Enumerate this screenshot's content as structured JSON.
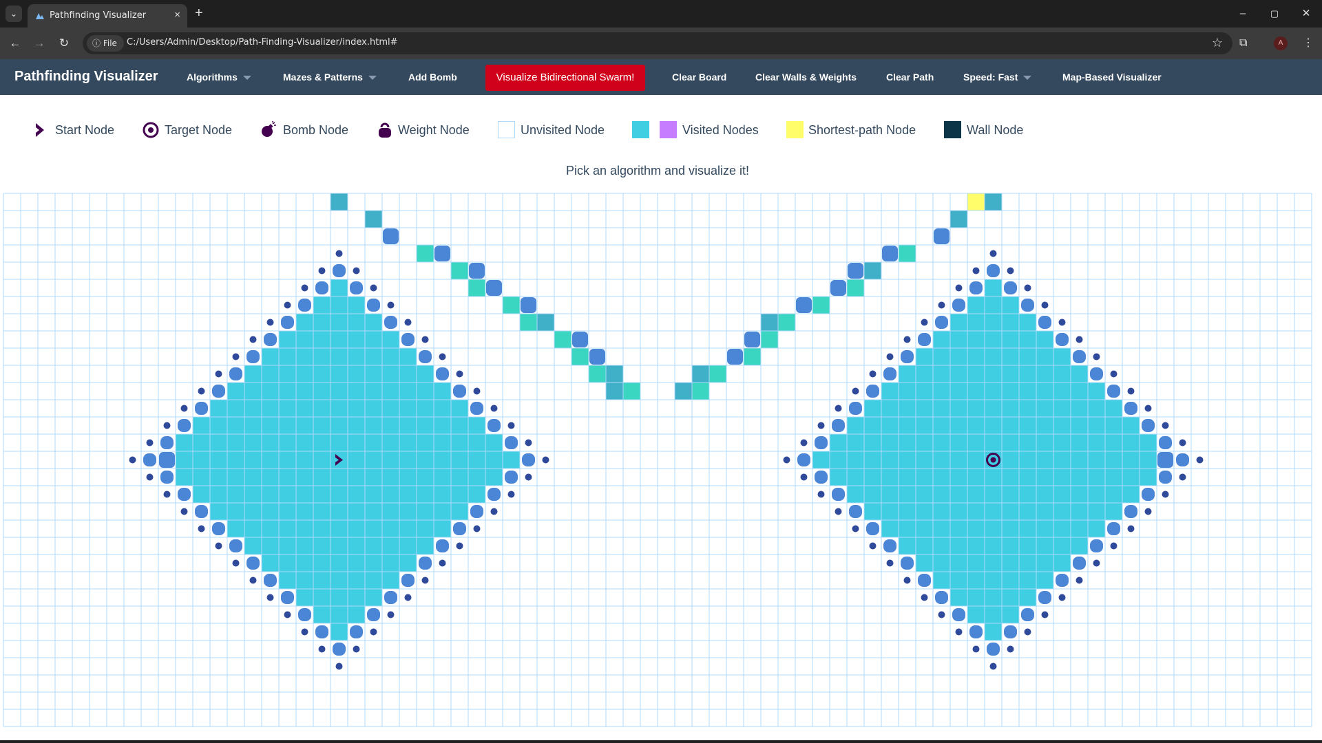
{
  "browser": {
    "tab_title": "Pathfinding Visualizer",
    "tab_close": "×",
    "new_tab": "+",
    "file_chip": "File",
    "url": "C:/Users/Admin/Desktop/Path-Finding-Visualizer/index.html#",
    "profile_initial": "A",
    "window_controls": [
      "–",
      "▢",
      "✕"
    ]
  },
  "nav": {
    "brand": "Pathfinding Visualizer",
    "algorithms": "Algorithms",
    "mazes": "Mazes & Patterns",
    "add_bomb": "Add Bomb",
    "visualize": "Visualize Bidirectional Swarm!",
    "clear_board": "Clear Board",
    "clear_walls": "Clear Walls & Weights",
    "clear_path": "Clear Path",
    "speed": "Speed: Fast",
    "map_based": "Map-Based Visualizer"
  },
  "legend": {
    "start": "Start Node",
    "target": "Target Node",
    "bomb": "Bomb Node",
    "weight": "Weight Node",
    "unvisited": "Unvisited Node",
    "visited": "Visited Nodes",
    "shortest": "Shortest-path Node",
    "wall": "Wall Node"
  },
  "instruction": "Pick an algorithm and visualize it!",
  "colors": {
    "nav_bg": "#34495e",
    "visualize_btn": "#d0021b",
    "visited": "#40cee3",
    "visited_alt": "#c77dff",
    "frontier_teal": "#3ad6c2",
    "frontier_dark": "#3fb0c8",
    "frontier_blue": "#4a85d6",
    "shortest": "#fffe6a",
    "wall": "#0c3547",
    "grid_line": "#afd8f8",
    "node_icon": "#44014f"
  },
  "grid": {
    "rows": 31,
    "cols": 76,
    "start": [
      15,
      19
    ],
    "target": [
      15,
      57
    ],
    "visited_radius": 10,
    "shortest_path_cells": [
      [
        0,
        56
      ]
    ],
    "frontier_cells": [
      [
        0,
        19,
        "dark"
      ],
      [
        1,
        21,
        "dark"
      ],
      [
        2,
        22,
        "blue"
      ],
      [
        3,
        24,
        "teal"
      ],
      [
        3,
        25,
        "blue"
      ],
      [
        4,
        26,
        "teal"
      ],
      [
        4,
        27,
        "blue"
      ],
      [
        5,
        27,
        "teal"
      ],
      [
        5,
        28,
        "blue"
      ],
      [
        6,
        29,
        "teal"
      ],
      [
        6,
        30,
        "blue"
      ],
      [
        7,
        30,
        "teal"
      ],
      [
        7,
        31,
        "dark"
      ],
      [
        8,
        32,
        "teal"
      ],
      [
        8,
        33,
        "blue"
      ],
      [
        9,
        33,
        "teal"
      ],
      [
        9,
        34,
        "blue"
      ],
      [
        10,
        34,
        "teal"
      ],
      [
        10,
        35,
        "dark"
      ],
      [
        11,
        35,
        "dark"
      ],
      [
        11,
        36,
        "teal"
      ],
      [
        15,
        9,
        "blue"
      ],
      [
        0,
        57,
        "dark"
      ],
      [
        1,
        55,
        "dark"
      ],
      [
        2,
        54,
        "blue"
      ],
      [
        3,
        52,
        "teal"
      ],
      [
        3,
        51,
        "blue"
      ],
      [
        4,
        50,
        "dark"
      ],
      [
        4,
        49,
        "blue"
      ],
      [
        5,
        49,
        "teal"
      ],
      [
        5,
        48,
        "blue"
      ],
      [
        6,
        47,
        "teal"
      ],
      [
        6,
        46,
        "blue"
      ],
      [
        7,
        45,
        "teal"
      ],
      [
        7,
        44,
        "dark"
      ],
      [
        8,
        44,
        "teal"
      ],
      [
        8,
        43,
        "blue"
      ],
      [
        9,
        43,
        "teal"
      ],
      [
        9,
        42,
        "blue"
      ],
      [
        10,
        41,
        "teal"
      ],
      [
        10,
        40,
        "dark"
      ],
      [
        11,
        40,
        "teal"
      ],
      [
        11,
        39,
        "dark"
      ],
      [
        15,
        67,
        "blue"
      ]
    ]
  }
}
